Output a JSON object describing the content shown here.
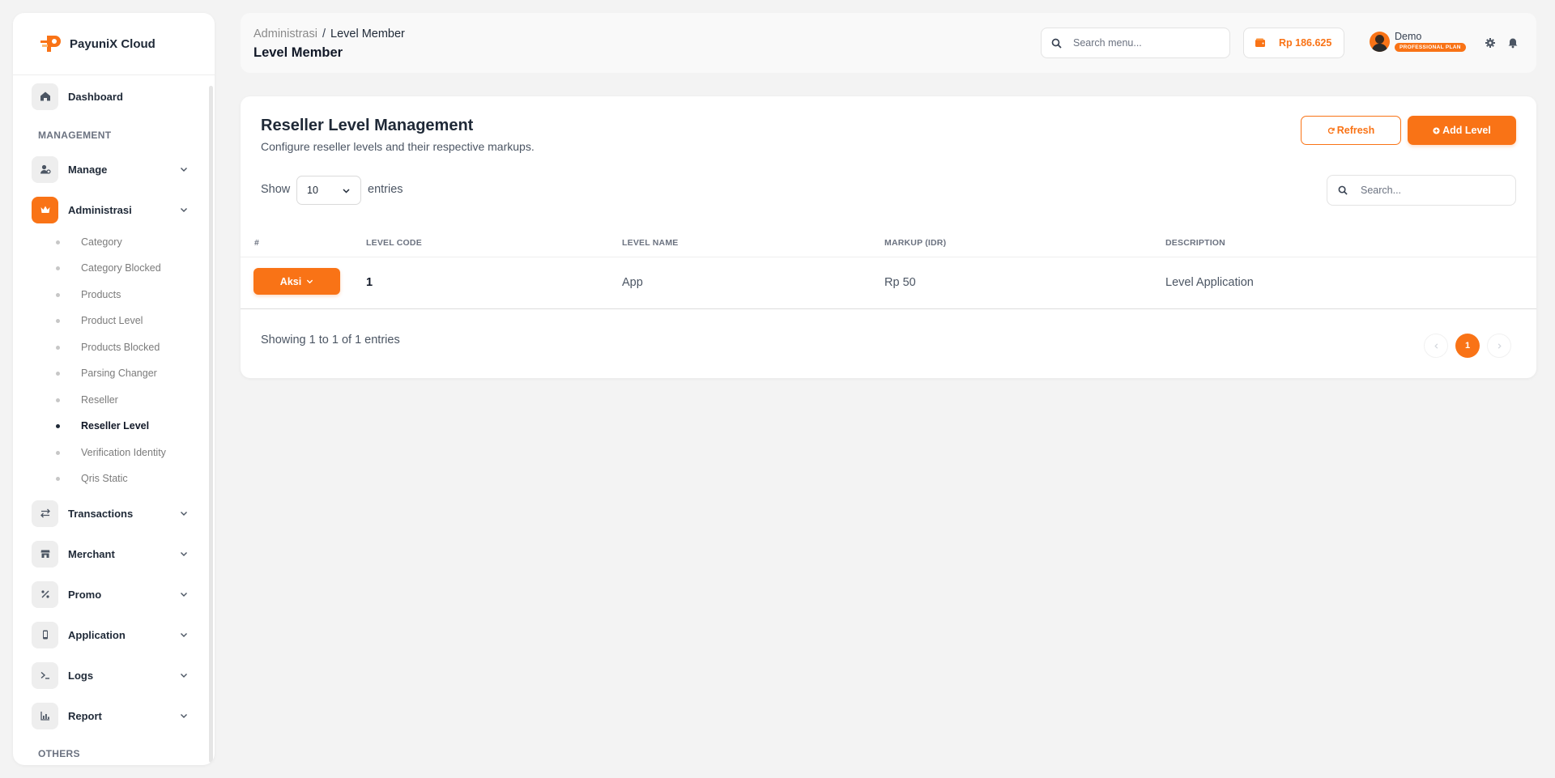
{
  "brand": {
    "name": "PayuniX Cloud"
  },
  "sidebar": {
    "dashboard": "Dashboard",
    "section_management": "MANAGEMENT",
    "manage": "Manage",
    "administrasi": "Administrasi",
    "sub_items": [
      {
        "label": "Category"
      },
      {
        "label": "Category Blocked"
      },
      {
        "label": "Products"
      },
      {
        "label": "Product Level"
      },
      {
        "label": "Products Blocked"
      },
      {
        "label": "Parsing Changer"
      },
      {
        "label": "Reseller"
      },
      {
        "label": "Reseller Level"
      },
      {
        "label": "Verification Identity"
      },
      {
        "label": "Qris Static"
      }
    ],
    "current_sub": "Reseller Level",
    "transactions": "Transactions",
    "merchant": "Merchant",
    "promo": "Promo",
    "application": "Application",
    "logs": "Logs",
    "report": "Report",
    "section_others": "OTHERS"
  },
  "header": {
    "breadcrumb_parent": "Administrasi",
    "breadcrumb_sep": "/",
    "breadcrumb_current": "Level Member",
    "page_title": "Level Member",
    "search_placeholder": "Search menu...",
    "balance": "Rp 186.625",
    "user_name": "Demo",
    "plan": "PROFESSIONAL PLAN"
  },
  "card": {
    "title": "Reseller Level Management",
    "subtitle": "Configure reseller levels and their respective markups.",
    "refresh_label": "Refresh",
    "add_label": "Add Level",
    "show_label": "Show",
    "entries_value": "10",
    "entries_label": "entries",
    "search_placeholder": "Search...",
    "columns": [
      "#",
      "LEVEL CODE",
      "LEVEL NAME",
      "MARKUP (IDR)",
      "DESCRIPTION"
    ],
    "rows": [
      {
        "action": "Aksi",
        "level_code": "1",
        "level_name": "App",
        "markup": "Rp 50",
        "description": "Level Application"
      }
    ],
    "showing": "Showing 1 to 1 of 1 entries",
    "current_page": "1"
  },
  "colors": {
    "accent": "#f97316",
    "background": "#f3f3f3",
    "card": "#ffffff"
  }
}
